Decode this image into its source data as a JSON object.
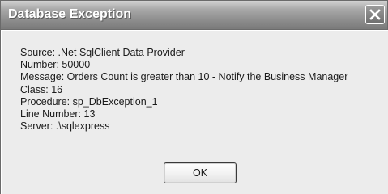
{
  "dialog": {
    "title": "Database Exception",
    "close_icon": "close-icon",
    "lines": [
      "Source: .Net SqlClient Data Provider",
      "Number: 50000",
      "Message: Orders Count is greater than 10 - Notify the Business Manager",
      "Class: 16",
      "Procedure: sp_DbException_1",
      "Line Number: 13",
      "Server: .\\sqlexpress"
    ],
    "ok_label": "OK"
  }
}
